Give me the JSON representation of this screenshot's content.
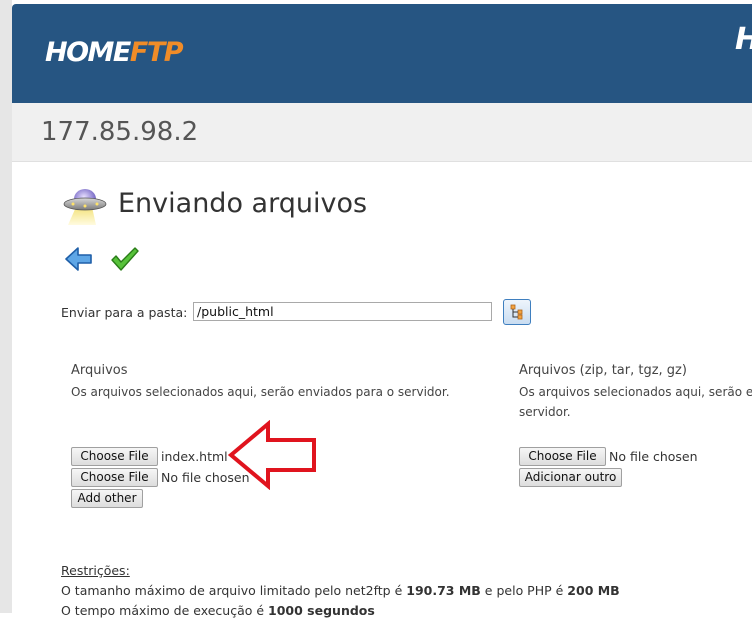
{
  "header": {
    "logo_main": "HOME",
    "logo_accent": "FTP",
    "right_cutoff": "H"
  },
  "server": {
    "ip": "177.85.98.2"
  },
  "page": {
    "title": "Enviando arquivos"
  },
  "toolbar": {
    "back_icon": "arrow-left-icon",
    "confirm_icon": "checkmark-icon"
  },
  "upload_folder": {
    "label": "Enviar para a pasta:",
    "value": "/public_html",
    "browse_icon": "folder-tree-icon"
  },
  "files_section": {
    "title": "Arquivos",
    "description": "Os arquivos selecionados aqui, serão enviados para o servidor.",
    "inputs": [
      {
        "button_label": "Choose File",
        "file_name": "index.html"
      },
      {
        "button_label": "Choose File",
        "file_name": "No file chosen"
      }
    ],
    "add_button": "Add other"
  },
  "archives_section": {
    "title": "Arquivos (zip, tar, tgz, gz)",
    "description_line1": "Os arquivos selecionados aqui, serão enviados e des",
    "description_line2": "servidor.",
    "inputs": [
      {
        "button_label": "Choose File",
        "file_name": "No file chosen"
      }
    ],
    "add_button": "Adicionar outro"
  },
  "restrictions": {
    "label": "Restrições:",
    "line1_prefix": "O tamanho máximo de arquivo limitado pelo net2ftp é ",
    "line1_value1": "190.73 MB",
    "line1_middle": " e pelo PHP é ",
    "line1_value2": "200 MB",
    "line2_prefix": "O tempo máximo de execução é ",
    "line2_value": "1000 segundos"
  },
  "colors": {
    "header_bg": "#265582",
    "logo_accent": "#f08c28",
    "annotation_arrow": "#e0141e"
  }
}
